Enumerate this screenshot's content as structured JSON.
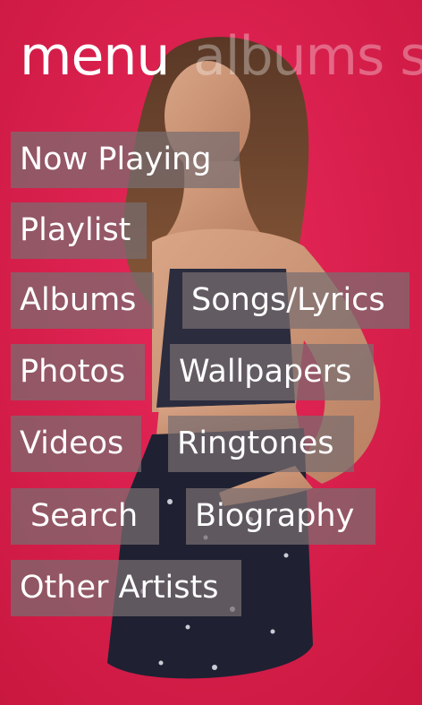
{
  "pivot": {
    "active": "menu",
    "next": "albums s"
  },
  "tiles": {
    "now_playing": "Now Playing",
    "playlist": "Playlist",
    "albums": "Albums",
    "songs_lyrics": "Songs/Lyrics",
    "photos": "Photos",
    "wallpapers": "Wallpapers",
    "videos": "Videos",
    "ringtones": "Ringtones",
    "search": "Search",
    "biography": "Biography",
    "other_artists": "Other Artists"
  },
  "colors": {
    "background": "#d81d4a",
    "tile": "#786e70",
    "text": "#ffffff"
  }
}
